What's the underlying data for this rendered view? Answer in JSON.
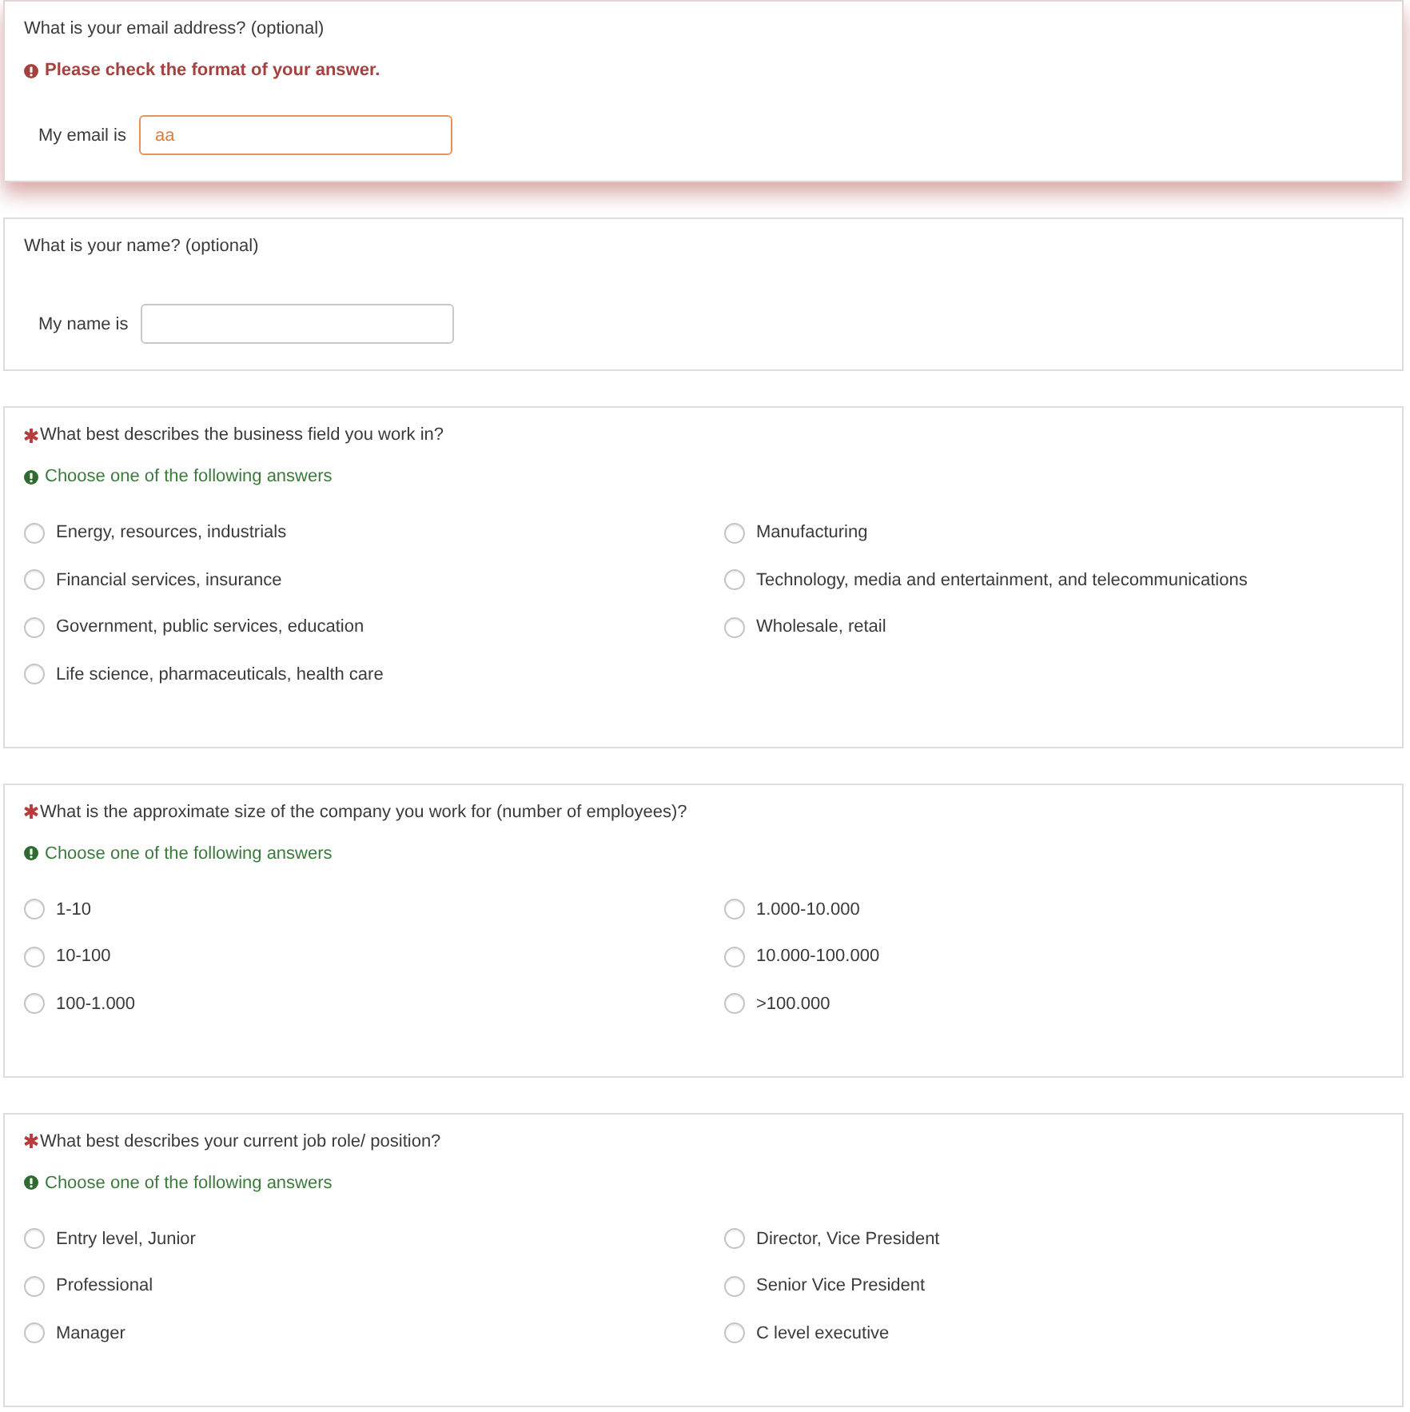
{
  "questions": [
    {
      "kind": "text",
      "required": false,
      "title": "What is your email address? (optional)",
      "message": {
        "kind": "error",
        "text": "Please check the format of your answer."
      },
      "field": {
        "label": "My email is",
        "value": "aa",
        "invalid": true
      }
    },
    {
      "kind": "text",
      "required": false,
      "title": "What is your name? (optional)",
      "field": {
        "label": "My name is",
        "invalid": false
      }
    },
    {
      "kind": "choice",
      "required": true,
      "title": "What best describes the business field you work in?",
      "message": {
        "kind": "hint",
        "text": "Choose one of the following answers"
      },
      "options": [
        {
          "label": "Energy, resources, industrials",
          "selected": false
        },
        {
          "label": "Manufacturing",
          "selected": false
        },
        {
          "label": "Financial services, insurance",
          "selected": false
        },
        {
          "label": "Technology, media and entertainment, and telecommunications",
          "selected": false
        },
        {
          "label": "Government, public services, education",
          "selected": false
        },
        {
          "label": "Wholesale, retail",
          "selected": false
        },
        {
          "label": "Life science, pharmaceuticals, health care",
          "selected": false
        }
      ]
    },
    {
      "kind": "choice",
      "required": true,
      "title": "What is the approximate size of the company you work for (number of employees)?",
      "message": {
        "kind": "hint",
        "text": "Choose one of the following answers"
      },
      "options": [
        {
          "label": "1-10",
          "selected": false
        },
        {
          "label": "1.000-10.000",
          "selected": false
        },
        {
          "label": "10-100",
          "selected": false
        },
        {
          "label": "10.000-100.000",
          "selected": false
        },
        {
          "label": "100-1.000",
          "selected": false
        },
        {
          "label": ">100.000",
          "selected": false
        }
      ]
    },
    {
      "kind": "choice",
      "required": true,
      "title": "What best describes your current job role/ position?",
      "message": {
        "kind": "hint",
        "text": "Choose one of the following answers"
      },
      "options": [
        {
          "label": "Entry level, Junior",
          "selected": false
        },
        {
          "label": "Director, Vice President",
          "selected": false
        },
        {
          "label": "Professional",
          "selected": false
        },
        {
          "label": "Senior Vice President",
          "selected": false
        },
        {
          "label": "Manager",
          "selected": false
        },
        {
          "label": "C level executive",
          "selected": false
        }
      ]
    }
  ]
}
